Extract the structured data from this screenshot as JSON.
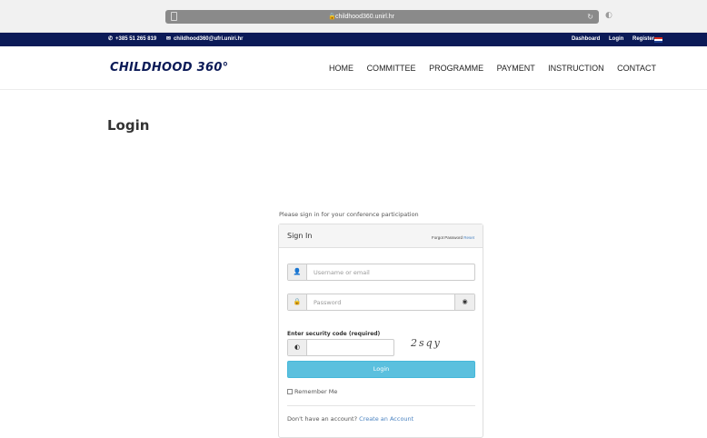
{
  "browser": {
    "url": "childhood360.unirl.hr",
    "lock_icon": "lock-icon",
    "reload_icon": "reload-icon"
  },
  "topbar": {
    "phone": "+385 51 265 819",
    "email": "childhood360@ufri.uniri.hr",
    "links": [
      "Dashboard",
      "Login",
      "Register"
    ]
  },
  "header": {
    "logo": "CHILDHOOD 360°",
    "nav": [
      "HOME",
      "COMMITTEE",
      "PROGRAMME",
      "PAYMENT",
      "INSTRUCTION",
      "CONTACT"
    ]
  },
  "page": {
    "title": "Login"
  },
  "login": {
    "intro": "Please sign in for your conference participation",
    "panel_title": "Sign In",
    "forgot_text": "Forgot Password",
    "reset_link": "Reset",
    "username_placeholder": "Username or email",
    "password_placeholder": "Password",
    "security_label": "Enter security code (required)",
    "captcha": "2sqy",
    "login_button": "Login",
    "remember_label": "Remember Me",
    "no_account_text": "Don't have an account?",
    "create_account_link": "Create an Account"
  },
  "colors": {
    "topbar_bg": "#0b1a57",
    "logo": "#0b1a57",
    "button": "#5bc0de",
    "link": "#4b83c1"
  }
}
